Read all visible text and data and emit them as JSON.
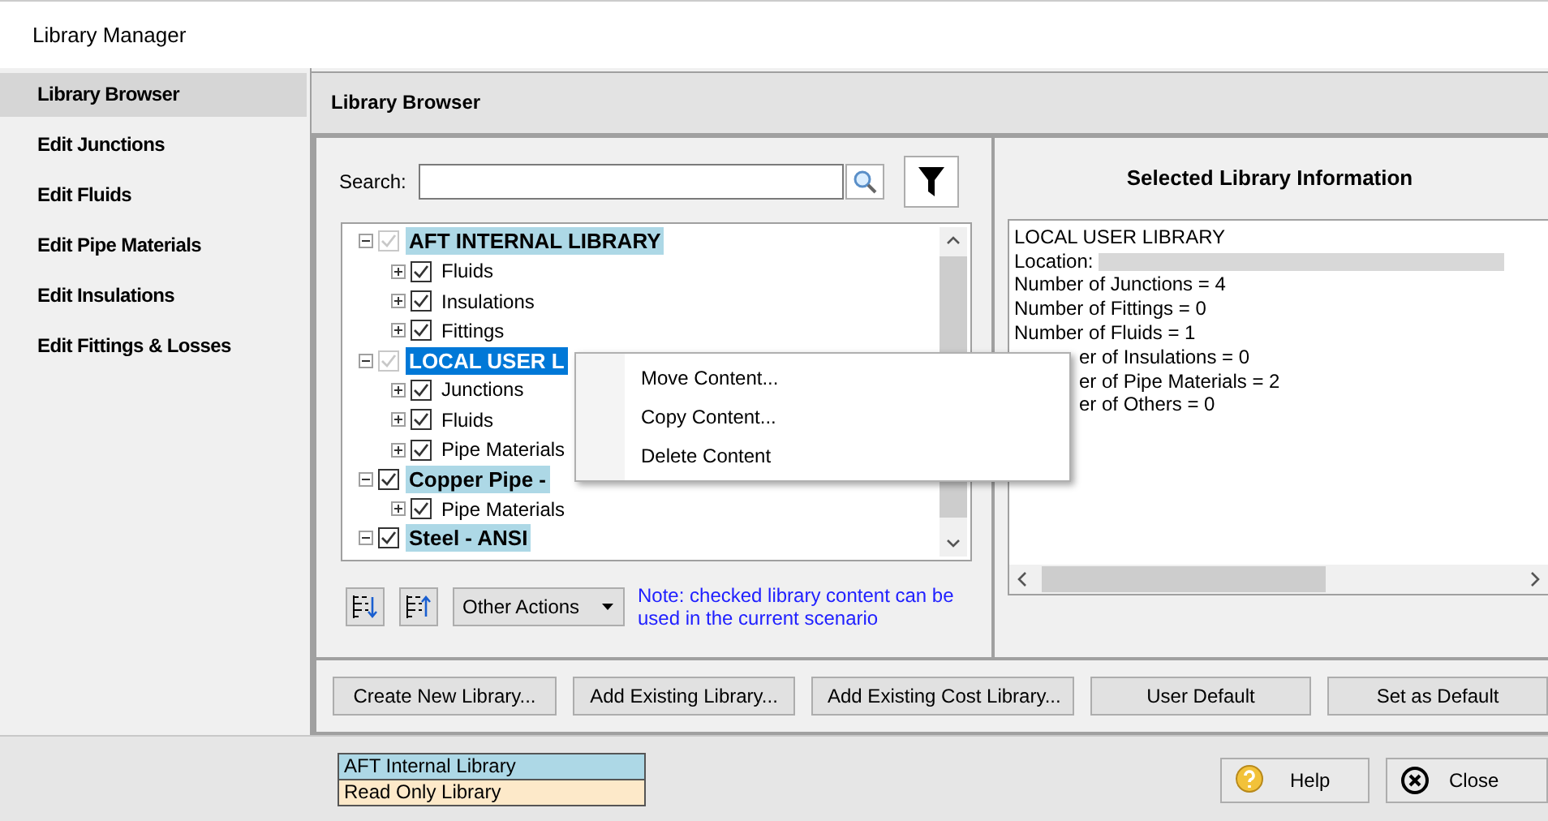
{
  "window": {
    "title": "Library Manager"
  },
  "sidebar": {
    "items": [
      {
        "label": "Library Browser",
        "selected": true
      },
      {
        "label": "Edit Junctions",
        "selected": false
      },
      {
        "label": "Edit Fluids",
        "selected": false
      },
      {
        "label": "Edit Pipe Materials",
        "selected": false
      },
      {
        "label": "Edit Insulations",
        "selected": false
      },
      {
        "label": "Edit Fittings & Losses",
        "selected": false
      }
    ]
  },
  "panel": {
    "title": "Library Browser"
  },
  "search": {
    "label": "Search:"
  },
  "tree": {
    "nodes": [
      {
        "label": "AFT INTERNAL LIBRARY",
        "checked": true,
        "disabled": true,
        "expanded": true,
        "selected": false,
        "color": "#add8e6",
        "children": [
          {
            "label": "Fluids",
            "checked": true,
            "disabled": false,
            "expanded": false,
            "selected": false
          },
          {
            "label": "Insulations",
            "checked": true,
            "disabled": false,
            "expanded": false,
            "selected": false
          },
          {
            "label": "Fittings",
            "checked": true,
            "disabled": false,
            "expanded": false,
            "selected": false
          }
        ]
      },
      {
        "label": "LOCAL USER L",
        "checked": true,
        "disabled": true,
        "expanded": true,
        "selected": true,
        "color": "#0078d7",
        "children": [
          {
            "label": "Junctions",
            "checked": true,
            "disabled": false,
            "expanded": false,
            "selected": false
          },
          {
            "label": "Fluids",
            "checked": true,
            "disabled": false,
            "expanded": false,
            "selected": false
          },
          {
            "label": "Pipe Materials",
            "checked": true,
            "disabled": false,
            "expanded": false,
            "selected": false
          }
        ]
      },
      {
        "label": "Copper Pipe -",
        "checked": true,
        "disabled": false,
        "expanded": true,
        "selected": false,
        "color": "#add8e6",
        "children": [
          {
            "label": "Pipe Materials",
            "checked": true,
            "disabled": false,
            "expanded": false,
            "selected": false
          }
        ]
      },
      {
        "label": "Steel - ANSI",
        "checked": true,
        "disabled": false,
        "expanded": true,
        "selected": false,
        "color": "#add8e6"
      }
    ]
  },
  "tree_tools": {
    "action_menu": "Other Actions",
    "note": "Note: checked library content can be used in the current scenario"
  },
  "context_menu": {
    "items": [
      "Move Content...",
      "Copy Content...",
      "Delete Content"
    ]
  },
  "info": {
    "title": "Selected Library Information",
    "lines": [
      {
        "text": "LOCAL USER LIBRARY",
        "kind": "line"
      },
      {
        "text": "Location:",
        "kind": "redacted"
      },
      {
        "text": "Number of Junctions = 4",
        "kind": "line"
      },
      {
        "text": "Number of Fittings = 0",
        "kind": "line"
      },
      {
        "text": "Number of Fluids = 1",
        "kind": "line"
      },
      {
        "text": "er of Insulations = 0",
        "kind": "covered"
      },
      {
        "text": "er of Pipe Materials = 2",
        "kind": "covered"
      },
      {
        "text": "er of Others = 0",
        "kind": "covered"
      }
    ]
  },
  "buttons": [
    "Create New Library...",
    "Add Existing Library...",
    "Add Existing Cost Library...",
    "User Default",
    "Set as Default"
  ],
  "legend": [
    {
      "label": "AFT Internal Library",
      "color": "#add8e6"
    },
    {
      "label": "Read Only Library",
      "color": "#fde9c9"
    }
  ],
  "footer_buttons": [
    {
      "label": "Help",
      "kind": "help"
    },
    {
      "label": "Close",
      "kind": "close"
    }
  ]
}
